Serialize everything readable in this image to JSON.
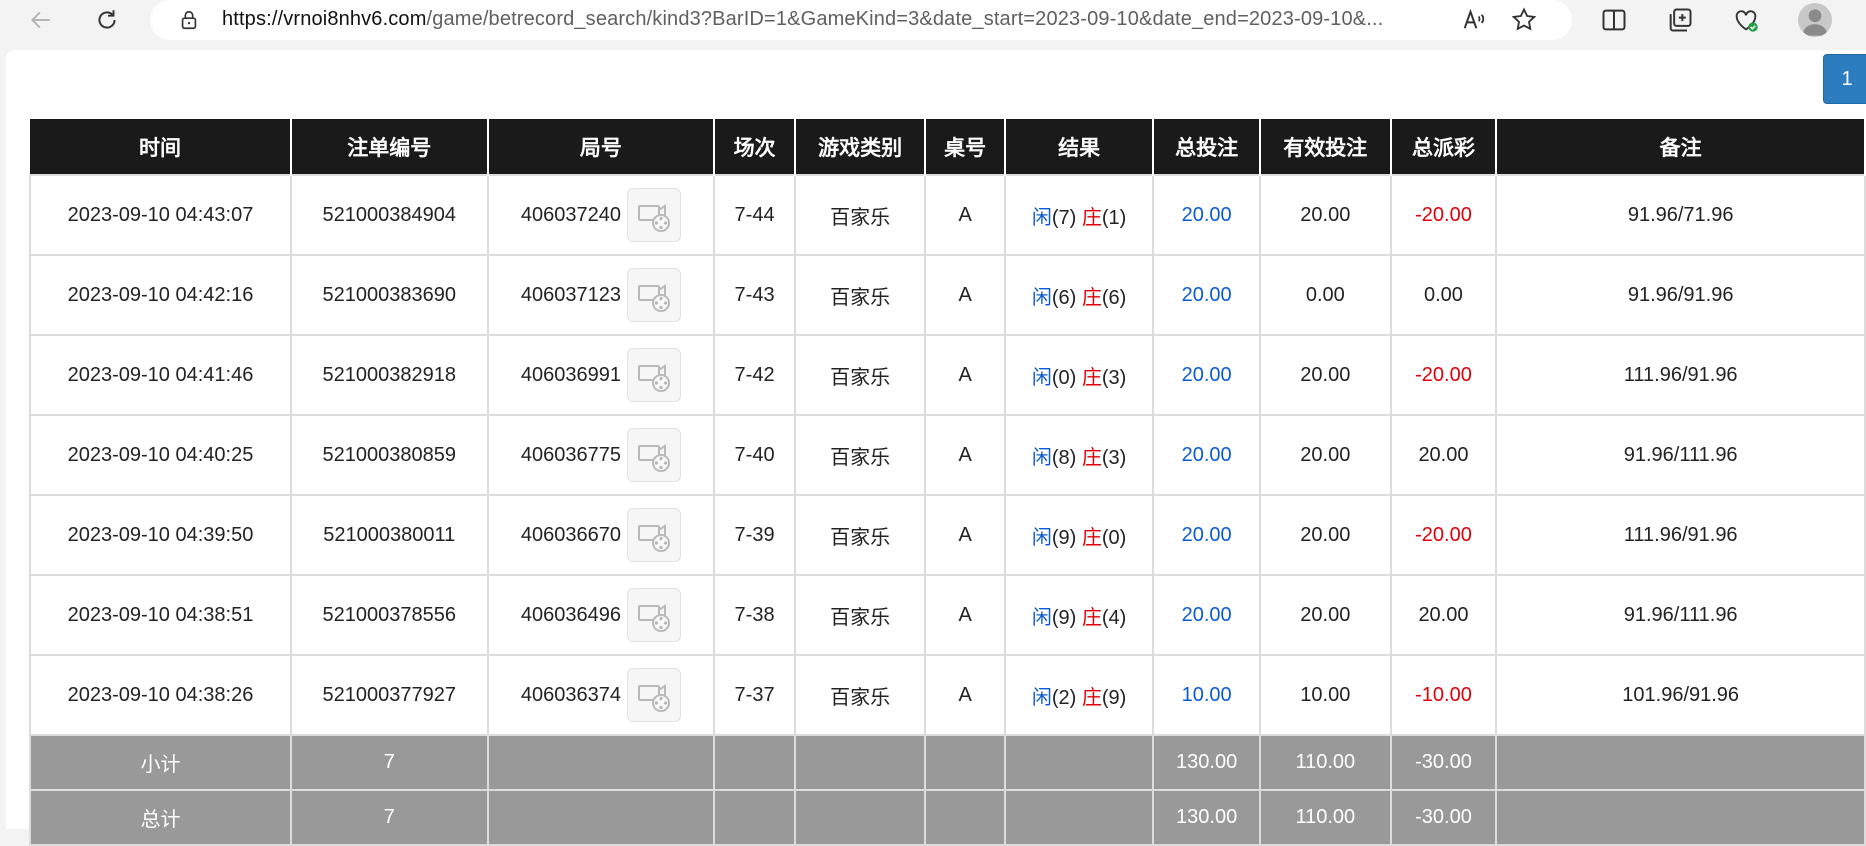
{
  "browser": {
    "url_host": "https://vrnoi8nhv6.com",
    "url_rest": "/game/betrecord_search/kind3?BarID=1&GameKind=3&date_start=2023-09-10&date_end=2023-09-10&..."
  },
  "pager": {
    "current_page": "1"
  },
  "table": {
    "headers": [
      "时间",
      "注单编号",
      "局号",
      "场次",
      "游戏类别",
      "桌号",
      "结果",
      "总投注",
      "有效投注",
      "总派彩",
      "备注"
    ],
    "rows": [
      {
        "time": "2023-09-10 04:43:07",
        "bet_id": "521000384904",
        "round": "406037240",
        "shoe": "7-44",
        "game": "百家乐",
        "table": "A",
        "player_label": "闲",
        "player_val": "(7)",
        "banker_label": "庄",
        "banker_val": "(1)",
        "total_bet": "20.00",
        "valid_bet": "20.00",
        "payout": "-20.00",
        "note": "91.96/71.96"
      },
      {
        "time": "2023-09-10 04:42:16",
        "bet_id": "521000383690",
        "round": "406037123",
        "shoe": "7-43",
        "game": "百家乐",
        "table": "A",
        "player_label": "闲",
        "player_val": "(6)",
        "banker_label": "庄",
        "banker_val": "(6)",
        "total_bet": "20.00",
        "valid_bet": "0.00",
        "payout": "0.00",
        "note": "91.96/91.96"
      },
      {
        "time": "2023-09-10 04:41:46",
        "bet_id": "521000382918",
        "round": "406036991",
        "shoe": "7-42",
        "game": "百家乐",
        "table": "A",
        "player_label": "闲",
        "player_val": "(0)",
        "banker_label": "庄",
        "banker_val": "(3)",
        "total_bet": "20.00",
        "valid_bet": "20.00",
        "payout": "-20.00",
        "note": "111.96/91.96"
      },
      {
        "time": "2023-09-10 04:40:25",
        "bet_id": "521000380859",
        "round": "406036775",
        "shoe": "7-40",
        "game": "百家乐",
        "table": "A",
        "player_label": "闲",
        "player_val": "(8)",
        "banker_label": "庄",
        "banker_val": "(3)",
        "total_bet": "20.00",
        "valid_bet": "20.00",
        "payout": "20.00",
        "note": "91.96/111.96"
      },
      {
        "time": "2023-09-10 04:39:50",
        "bet_id": "521000380011",
        "round": "406036670",
        "shoe": "7-39",
        "game": "百家乐",
        "table": "A",
        "player_label": "闲",
        "player_val": "(9)",
        "banker_label": "庄",
        "banker_val": "(0)",
        "total_bet": "20.00",
        "valid_bet": "20.00",
        "payout": "-20.00",
        "note": "111.96/91.96"
      },
      {
        "time": "2023-09-10 04:38:51",
        "bet_id": "521000378556",
        "round": "406036496",
        "shoe": "7-38",
        "game": "百家乐",
        "table": "A",
        "player_label": "闲",
        "player_val": "(9)",
        "banker_label": "庄",
        "banker_val": "(4)",
        "total_bet": "20.00",
        "valid_bet": "20.00",
        "payout": "20.00",
        "note": "91.96/111.96"
      },
      {
        "time": "2023-09-10 04:38:26",
        "bet_id": "521000377927",
        "round": "406036374",
        "shoe": "7-37",
        "game": "百家乐",
        "table": "A",
        "player_label": "闲",
        "player_val": "(2)",
        "banker_label": "庄",
        "banker_val": "(9)",
        "total_bet": "10.00",
        "valid_bet": "10.00",
        "payout": "-10.00",
        "note": "101.96/91.96"
      }
    ],
    "subtotal": {
      "label": "小计",
      "count": "7",
      "total_bet": "130.00",
      "valid_bet": "110.00",
      "payout": "-30.00"
    },
    "grand_total": {
      "label": "总计",
      "count": "7",
      "total_bet": "130.00",
      "valid_bet": "110.00",
      "payout": "-30.00"
    }
  },
  "colors": {
    "header_bg": "#1a1a1a",
    "summary_bg": "#999999",
    "positive_blue": "#0b5bd6",
    "negative_red": "#e0000a",
    "pager_blue": "#2b7dbf"
  }
}
